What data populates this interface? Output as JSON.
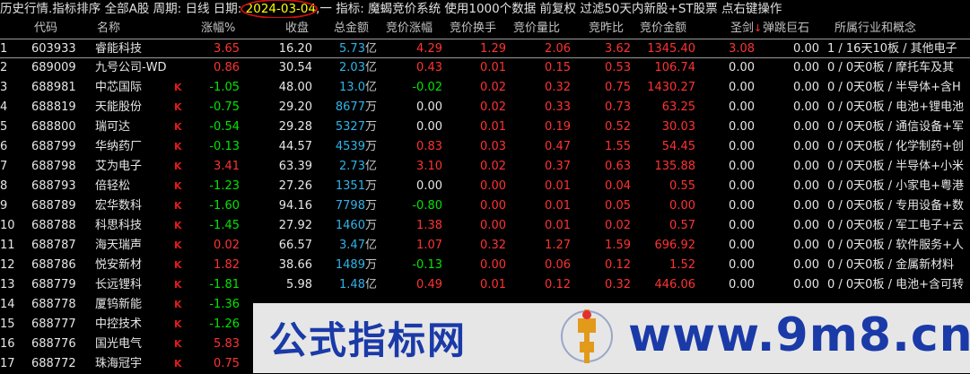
{
  "titlebar": {
    "module": "历史行情.指标排序",
    "scope": "全部A股",
    "period_label": "周期:",
    "period_value": "日线",
    "date_label": "日期:",
    "date_value": "2024-03-04",
    "sep": ",一",
    "indicator_label": "指标:",
    "indicator_value": "魔蝎竞价系统",
    "data_note": "使用1000个数据",
    "adjust": "前复权",
    "filter": "过滤50天内新股+ST股票",
    "hint": "点右键操作"
  },
  "columns": [
    "代码",
    "名称",
    "涨幅%",
    "收盘",
    "总金额",
    "竞价涨幅",
    "竞价换手",
    "竞价量比",
    "竞昨比",
    "竞价金额",
    "圣剑",
    "弹跳巨石",
    "所属行业和概念"
  ],
  "sort_arrow": "↓",
  "rows": [
    {
      "idx": "1",
      "code": "603933",
      "name": "睿能科技",
      "k": "",
      "chg": "3.65",
      "chg_dir": "up",
      "close": "16.20",
      "amt": "5.73",
      "amt_unit": "亿",
      "bid_chg": "4.29",
      "bid_dir": "up",
      "turn": "1.29",
      "ratio": "2.06",
      "yest": "3.62",
      "bid_amt": "1345.40",
      "sword": "3.08",
      "rock": "0.00",
      "sector": "1 / 16天10板 / 其他电子"
    },
    {
      "idx": "2",
      "code": "689009",
      "name": "九号公司-WD",
      "k": "",
      "chg": "0.86",
      "chg_dir": "up",
      "close": "30.54",
      "amt": "2.03",
      "amt_unit": "亿",
      "bid_chg": "0.43",
      "bid_dir": "up",
      "turn": "0.01",
      "ratio": "0.15",
      "yest": "0.53",
      "bid_amt": "106.74",
      "sword": "0.00",
      "rock": "0.00",
      "sector": "0 / 0天0板 / 摩托车及其"
    },
    {
      "idx": "3",
      "code": "688981",
      "name": "中芯国际",
      "k": "K",
      "chg": "-1.05",
      "chg_dir": "down",
      "close": "48.00",
      "amt": "13.0",
      "amt_unit": "亿",
      "bid_chg": "-0.02",
      "bid_dir": "down",
      "turn": "0.02",
      "ratio": "0.32",
      "yest": "0.75",
      "bid_amt": "1430.27",
      "sword": "0.00",
      "rock": "0.00",
      "sector": "0 / 0天0板 / 半导体+含H"
    },
    {
      "idx": "4",
      "code": "688819",
      "name": "天能股份",
      "k": "K",
      "chg": "-0.75",
      "chg_dir": "down",
      "close": "29.20",
      "amt": "8677",
      "amt_unit": "万",
      "bid_chg": "0.00",
      "bid_dir": "flat",
      "turn": "0.02",
      "ratio": "0.33",
      "yest": "0.73",
      "bid_amt": "63.25",
      "sword": "0.00",
      "rock": "0.00",
      "sector": "0 / 0天0板 / 电池+锂电池"
    },
    {
      "idx": "5",
      "code": "688800",
      "name": "瑞可达",
      "k": "K",
      "chg": "-0.54",
      "chg_dir": "down",
      "close": "29.28",
      "amt": "5327",
      "amt_unit": "万",
      "bid_chg": "0.00",
      "bid_dir": "flat",
      "turn": "0.01",
      "ratio": "0.19",
      "yest": "0.52",
      "bid_amt": "30.03",
      "sword": "0.00",
      "rock": "0.00",
      "sector": "0 / 0天0板 / 通信设备+军"
    },
    {
      "idx": "6",
      "code": "688799",
      "name": "华纳药厂",
      "k": "K",
      "chg": "-0.13",
      "chg_dir": "down",
      "close": "44.57",
      "amt": "4539",
      "amt_unit": "万",
      "bid_chg": "0.83",
      "bid_dir": "up",
      "turn": "0.03",
      "ratio": "0.47",
      "yest": "1.55",
      "bid_amt": "54.45",
      "sword": "0.00",
      "rock": "0.00",
      "sector": "0 / 0天0板 / 化学制药+创"
    },
    {
      "idx": "7",
      "code": "688798",
      "name": "艾为电子",
      "k": "K",
      "chg": "3.41",
      "chg_dir": "up",
      "close": "63.39",
      "amt": "2.73",
      "amt_unit": "亿",
      "bid_chg": "3.10",
      "bid_dir": "up",
      "turn": "0.02",
      "ratio": "0.37",
      "yest": "0.63",
      "bid_amt": "135.88",
      "sword": "0.00",
      "rock": "0.00",
      "sector": "0 / 0天0板 / 半导体+小米"
    },
    {
      "idx": "8",
      "code": "688793",
      "name": "倍轻松",
      "k": "K",
      "chg": "-1.23",
      "chg_dir": "down",
      "close": "27.26",
      "amt": "1351",
      "amt_unit": "万",
      "bid_chg": "0.00",
      "bid_dir": "flat",
      "turn": "0.00",
      "ratio": "0.01",
      "yest": "0.04",
      "bid_amt": "0.55",
      "sword": "0.00",
      "rock": "0.00",
      "sector": "0 / 0天0板 / 小家电+粤港"
    },
    {
      "idx": "9",
      "code": "688789",
      "name": "宏华数科",
      "k": "K",
      "chg": "-1.60",
      "chg_dir": "down",
      "close": "94.16",
      "amt": "7798",
      "amt_unit": "万",
      "bid_chg": "-0.80",
      "bid_dir": "down",
      "turn": "0.00",
      "ratio": "0.01",
      "yest": "0.05",
      "bid_amt": "0.00",
      "sword": "0.00",
      "rock": "0.00",
      "sector": "0 / 0天0板 / 专用设备+数"
    },
    {
      "idx": "10",
      "code": "688788",
      "name": "科思科技",
      "k": "K",
      "chg": "-1.45",
      "chg_dir": "down",
      "close": "27.92",
      "amt": "1460",
      "amt_unit": "万",
      "bid_chg": "1.38",
      "bid_dir": "up",
      "turn": "0.00",
      "ratio": "0.01",
      "yest": "0.02",
      "bid_amt": "0.57",
      "sword": "0.00",
      "rock": "0.00",
      "sector": "0 / 0天0板 / 军工电子+云"
    },
    {
      "idx": "11",
      "code": "688787",
      "name": "海天瑞声",
      "k": "K",
      "chg": "0.02",
      "chg_dir": "up",
      "close": "66.57",
      "amt": "3.47",
      "amt_unit": "亿",
      "bid_chg": "1.07",
      "bid_dir": "up",
      "turn": "0.32",
      "ratio": "1.27",
      "yest": "1.59",
      "bid_amt": "696.92",
      "sword": "0.00",
      "rock": "0.00",
      "sector": "0 / 0天0板 / 软件服务+人"
    },
    {
      "idx": "12",
      "code": "688786",
      "name": "悦安新材",
      "k": "K",
      "chg": "1.82",
      "chg_dir": "up",
      "close": "38.66",
      "amt": "1489",
      "amt_unit": "万",
      "bid_chg": "-0.13",
      "bid_dir": "down",
      "turn": "0.00",
      "ratio": "0.06",
      "yest": "0.12",
      "bid_amt": "1.52",
      "sword": "0.00",
      "rock": "0.00",
      "sector": "0 / 0天0板 / 金属新材料"
    },
    {
      "idx": "13",
      "code": "688779",
      "name": "长远锂科",
      "k": "K",
      "chg": "-1.81",
      "chg_dir": "down",
      "close": "5.98",
      "amt": "1.48",
      "amt_unit": "亿",
      "bid_chg": "0.49",
      "bid_dir": "up",
      "turn": "0.01",
      "ratio": "0.12",
      "yest": "0.32",
      "bid_amt": "446.06",
      "sword": "0.00",
      "rock": "0.00",
      "sector": "0 / 0天0板 / 电池+含可转"
    },
    {
      "idx": "14",
      "code": "688778",
      "name": "厦钨新能",
      "k": "K",
      "chg": "-1.36",
      "chg_dir": "down",
      "close": "",
      "amt": "",
      "amt_unit": "",
      "bid_chg": "",
      "bid_dir": "flat",
      "turn": "",
      "ratio": "",
      "yest": "",
      "bid_amt": "",
      "sword": "",
      "rock": "",
      "sector": ""
    },
    {
      "idx": "15",
      "code": "688777",
      "name": "中控技术",
      "k": "K",
      "chg": "-1.26",
      "chg_dir": "down",
      "close": "",
      "amt": "",
      "amt_unit": "",
      "bid_chg": "",
      "bid_dir": "flat",
      "turn": "",
      "ratio": "",
      "yest": "",
      "bid_amt": "",
      "sword": "",
      "rock": "",
      "sector": ""
    },
    {
      "idx": "16",
      "code": "688776",
      "name": "国光电气",
      "k": "K",
      "chg": "5.83",
      "chg_dir": "up",
      "close": "",
      "amt": "",
      "amt_unit": "",
      "bid_chg": "",
      "bid_dir": "flat",
      "turn": "",
      "ratio": "",
      "yest": "",
      "bid_amt": "",
      "sword": "",
      "rock": "",
      "sector": ""
    },
    {
      "idx": "17",
      "code": "688772",
      "name": "珠海冠宇",
      "k": "K",
      "chg": "0.75",
      "chg_dir": "up",
      "close": "",
      "amt": "",
      "amt_unit": "",
      "bid_chg": "",
      "bid_dir": "flat",
      "turn": "",
      "ratio": "",
      "yest": "",
      "bid_amt": "",
      "sword": "",
      "rock": "",
      "sector": ""
    }
  ],
  "watermark": {
    "text_cn": "公式指标网",
    "text_url": "www.9m8.cn",
    "logo_text": "www.9m8.cn"
  }
}
